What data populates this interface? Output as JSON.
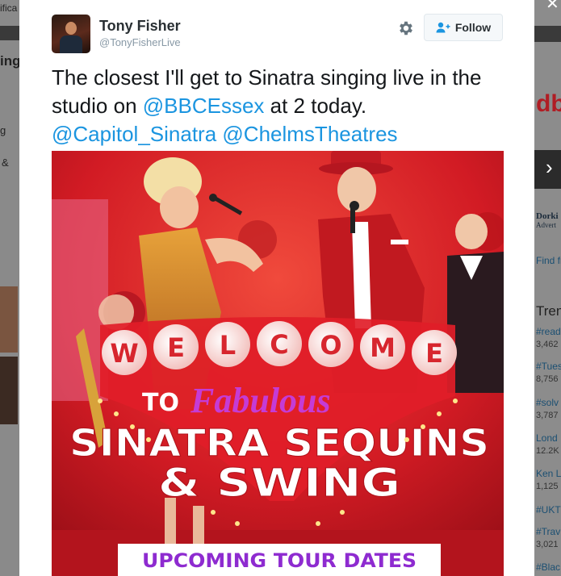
{
  "background": {
    "left_fragments": [
      "ifica",
      "ing",
      "g",
      "&"
    ],
    "right_fragments": {
      "brand": "db",
      "promo_title": "Dorki",
      "promo_sub": "Advert",
      "find_link": "Find fr",
      "trends_heading": "Tren",
      "trends": [
        {
          "tag": "#read",
          "count": "3,462"
        },
        {
          "tag": "#Tues",
          "count": "8,756"
        },
        {
          "tag": "#solv",
          "count": "3,787"
        },
        {
          "tag": "Lond",
          "count": "12.2K"
        },
        {
          "tag": "Ken L",
          "count": "1,125"
        },
        {
          "tag": "#UKT",
          "count": ""
        },
        {
          "tag": "#Trav",
          "count": "3,021"
        },
        {
          "tag": "#Blac",
          "count": ""
        }
      ]
    }
  },
  "tweet": {
    "author_name": "Tony Fisher",
    "author_handle": "@TonyFisherLive",
    "follow_label": "Follow",
    "text_line1": "The closest I'll get to Sinatra singing live in the",
    "text_line2_prefix": "studio on ",
    "mention1": "@BBCEssex",
    "text_line2_suffix": " at 2 today.",
    "mention2": "@Capitol_Sinatra",
    "mention3": "@ChelmsTheatres"
  },
  "image": {
    "welcome": [
      "W",
      "E",
      "L",
      "C",
      "O",
      "M",
      "E"
    ],
    "to": "TO",
    "fabulous": "Fabulous",
    "title_line1": "SINATRA SEQUINS",
    "title_line2": "& SWING",
    "banner": "UPCOMING TOUR DATES"
  },
  "icons": {
    "gear": "gear-icon",
    "follow": "add-user-icon",
    "close": "close-icon"
  },
  "colors": {
    "link": "#1b95e0",
    "poster_red": "#d81d27",
    "banner_text": "#8e2bd0"
  }
}
